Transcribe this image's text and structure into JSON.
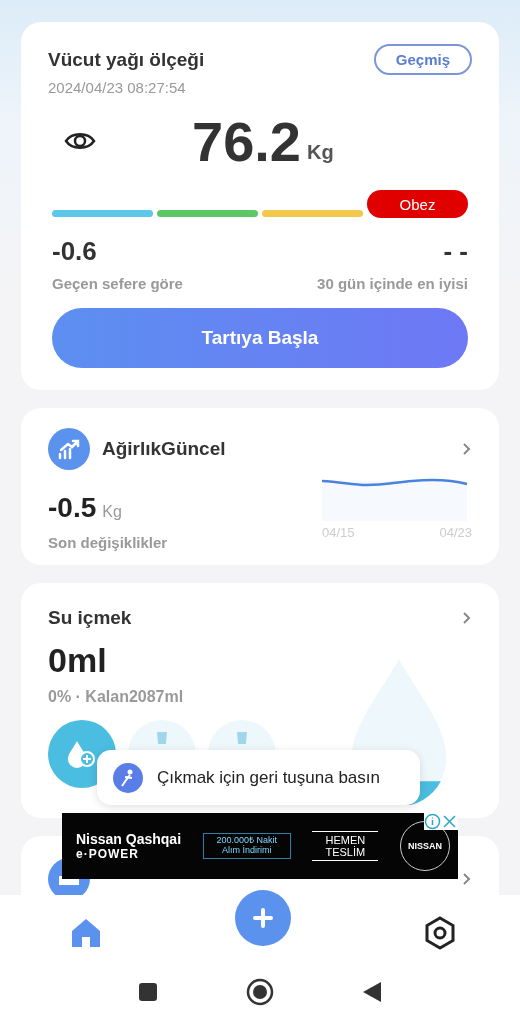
{
  "scale_card": {
    "title": "Vücut yağı ölçeği",
    "history_button": "Geçmiş",
    "timestamp": "2024/04/23 08:27:54",
    "weight": "76.2",
    "unit": "Kg",
    "segments": [
      {
        "color": "#5bc8ea",
        "selected": false
      },
      {
        "color": "#5cc766",
        "selected": false
      },
      {
        "color": "#f2c94c",
        "selected": false
      },
      {
        "color": "#e00000",
        "selected": true,
        "label": "Obez"
      }
    ],
    "stats": [
      {
        "value": "-0.6",
        "label": "Geçen sefere göre"
      },
      {
        "value": "- -",
        "label": "30 gün içinde en iyisi"
      }
    ],
    "start_button": "Tartıya Başla"
  },
  "trend_card": {
    "title": "AğirlıkGüncel",
    "change": "-0.5",
    "unit": "Kg",
    "caption": "Son değişiklikler",
    "x_labels": [
      "04/15",
      "04/23"
    ]
  },
  "water_card": {
    "title": "Su içmek",
    "amount": "0ml",
    "progress": "0% · Kalan2087ml"
  },
  "toast": {
    "text": "Çıkmak için geri tuşuna basın"
  },
  "ad": {
    "model": "Nissan Qashqai",
    "line": "e·POWER",
    "offer": "200.000₺ Nakit Alım İndirimi",
    "cta": "HEMEN TESLİM",
    "brand": "NISSAN"
  },
  "bottom_nav": [
    {
      "kind": "home",
      "selected": true
    },
    {
      "kind": "add",
      "selected": false
    },
    {
      "kind": "settings",
      "selected": false
    }
  ]
}
